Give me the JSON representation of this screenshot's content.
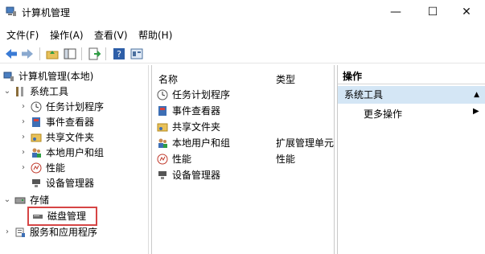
{
  "window": {
    "title": "计算机管理",
    "minimize": "—",
    "maximize": "☐",
    "close": "✕"
  },
  "menu": [
    "文件(F)",
    "操作(A)",
    "查看(V)",
    "帮助(H)"
  ],
  "tree": {
    "root": "计算机管理(本地)",
    "system_tools": "系统工具",
    "task_scheduler": "任务计划程序",
    "event_viewer": "事件查看器",
    "shared_folders": "共享文件夹",
    "local_users": "本地用户和组",
    "performance": "性能",
    "device_manager": "设备管理器",
    "storage": "存储",
    "disk_management": "磁盘管理",
    "services": "服务和应用程序"
  },
  "list": {
    "col_name": "名称",
    "col_type": "类型",
    "rows": [
      {
        "name": "任务计划程序",
        "type": ""
      },
      {
        "name": "事件查看器",
        "type": ""
      },
      {
        "name": "共享文件夹",
        "type": ""
      },
      {
        "name": "本地用户和组",
        "type": "扩展管理单元"
      },
      {
        "name": "性能",
        "type": "性能"
      },
      {
        "name": "设备管理器",
        "type": ""
      }
    ]
  },
  "actions": {
    "header": "操作",
    "section": "系统工具",
    "more": "更多操作"
  },
  "colors": {
    "selection_bg": "#d4e6f5",
    "highlight_border": "#d64545",
    "toolbar_arrow": "#3a7bd5"
  }
}
